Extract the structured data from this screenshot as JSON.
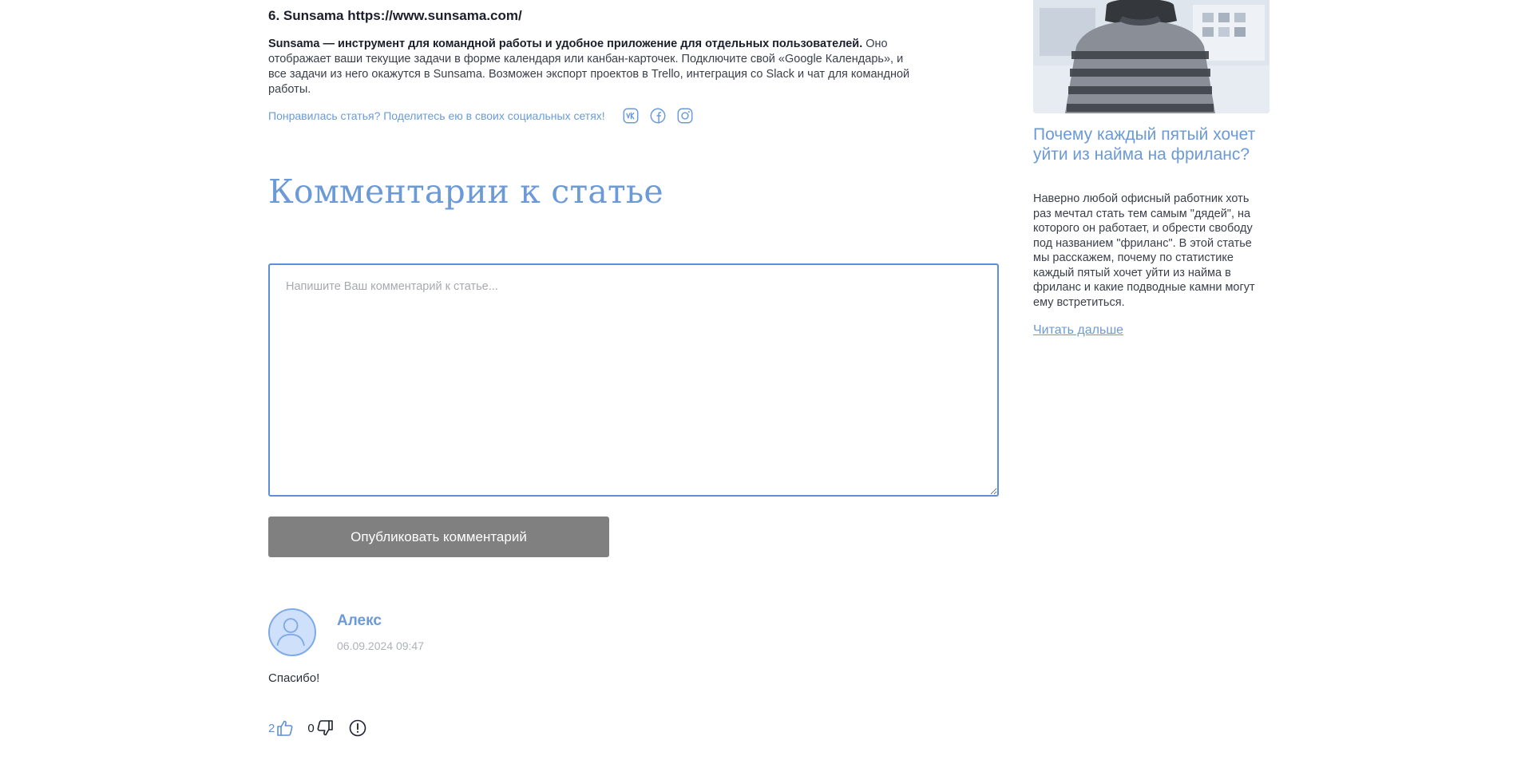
{
  "article": {
    "section_title": "6. Sunsama https://www.sunsama.com/",
    "intro_bold": "Sunsama — инструмент для командной работы и удобное приложение для отдельных пользователей.",
    "intro_rest": " Оно отображает ваши текущие задачи в форме календаря или канбан-карточек. Подключите свой «Google Календарь», и все задачи из него окажутся в Sunsama. Возможен экспорт проектов в Trello, интеграция со Slack и чат для командной работы.",
    "share_text": "Понравилась статья? Поделитесь ею в своих социальных сетях!",
    "share_icons": [
      "vk-icon",
      "facebook-icon",
      "instagram-icon"
    ]
  },
  "comments": {
    "heading": "Комментарии к статье",
    "textarea_placeholder": "Напишите Ваш комментарий к статье...",
    "publish_label": "Опубликовать комментарий",
    "items": [
      {
        "author": "Алекс",
        "date": "06.09.2024 09:47",
        "text": "Спасибо!",
        "likes": "2",
        "dislikes": "0"
      }
    ]
  },
  "sidebar": {
    "card": {
      "title": "Почему каждый пятый хочет уйти из найма на фриланс?",
      "description": "Наверно любой офисный работник хоть раз мечтал стать тем самым \"дядей\", на которого он работает, и обрести свободу под названием \"фриланс\". В этой статье мы расскажем, почему по статистике каждый пятый хочет уйти из найма в фриланс и какие подводные камни могут ему встретиться.",
      "read_more": "Читать дальше"
    }
  },
  "colors": {
    "accent": "#6b9ad6",
    "button": "#808080",
    "textarea_border": "#5d8fd8"
  }
}
